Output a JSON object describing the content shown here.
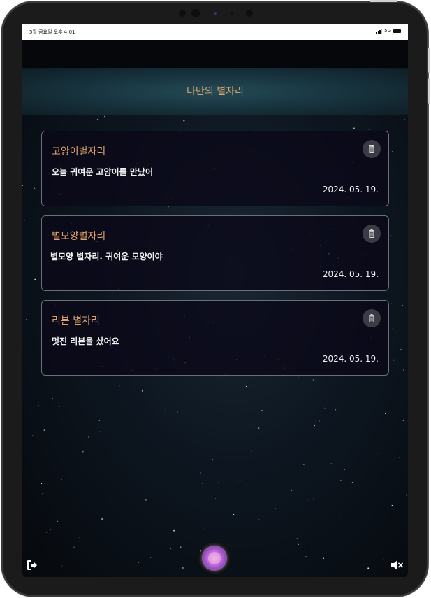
{
  "status_bar": {
    "time": "5월 금요일 오후 4:01",
    "network": "5G"
  },
  "page": {
    "title": "나만의 별자리"
  },
  "cards": [
    {
      "title": "고양이별자리",
      "body": "오늘 귀여운 고양이를 만났어",
      "date": "2024. 05. 19."
    },
    {
      "title": "별모양별자리",
      "body": "별모양 별자리. 귀여운 모양이야",
      "date": "2024. 05. 19."
    },
    {
      "title": "리본 별자리",
      "body": "멋진 리본을 샀어요",
      "date": "2024. 05. 19."
    }
  ],
  "icons": {
    "delete": "trash-icon",
    "logout": "logout-icon",
    "main_action": "orb-icon",
    "sound": "mute-icon"
  },
  "colors": {
    "accent": "#e0a46b",
    "card_border": "#6b6f7a",
    "background": "#0d1620"
  }
}
